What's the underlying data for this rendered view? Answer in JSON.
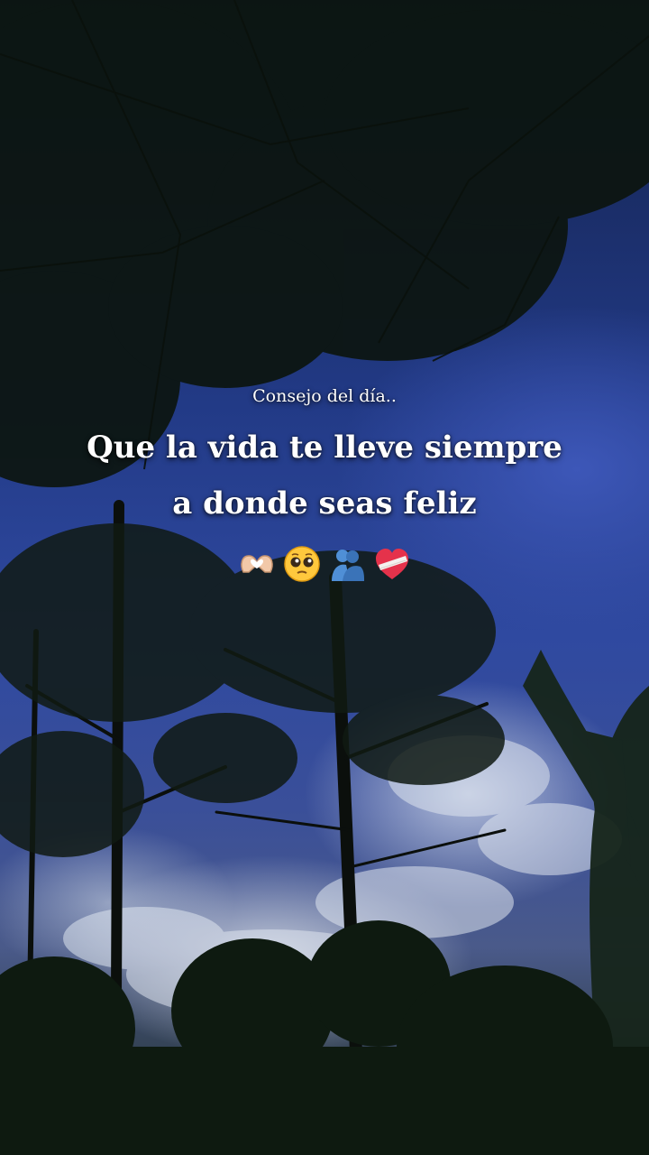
{
  "overlay": {
    "subtitle": "Consejo del día..",
    "quote_line_1": "Que la vida te lleve siempre",
    "quote_line_2": "a donde seas feliz"
  },
  "emojis": [
    "heart-hands-icon",
    "pleading-face-icon",
    "people-hugging-icon",
    "mending-heart-icon"
  ],
  "colors": {
    "sky": "#2f49a0",
    "foliage": "#0f1a12",
    "text": "#ffffff"
  }
}
